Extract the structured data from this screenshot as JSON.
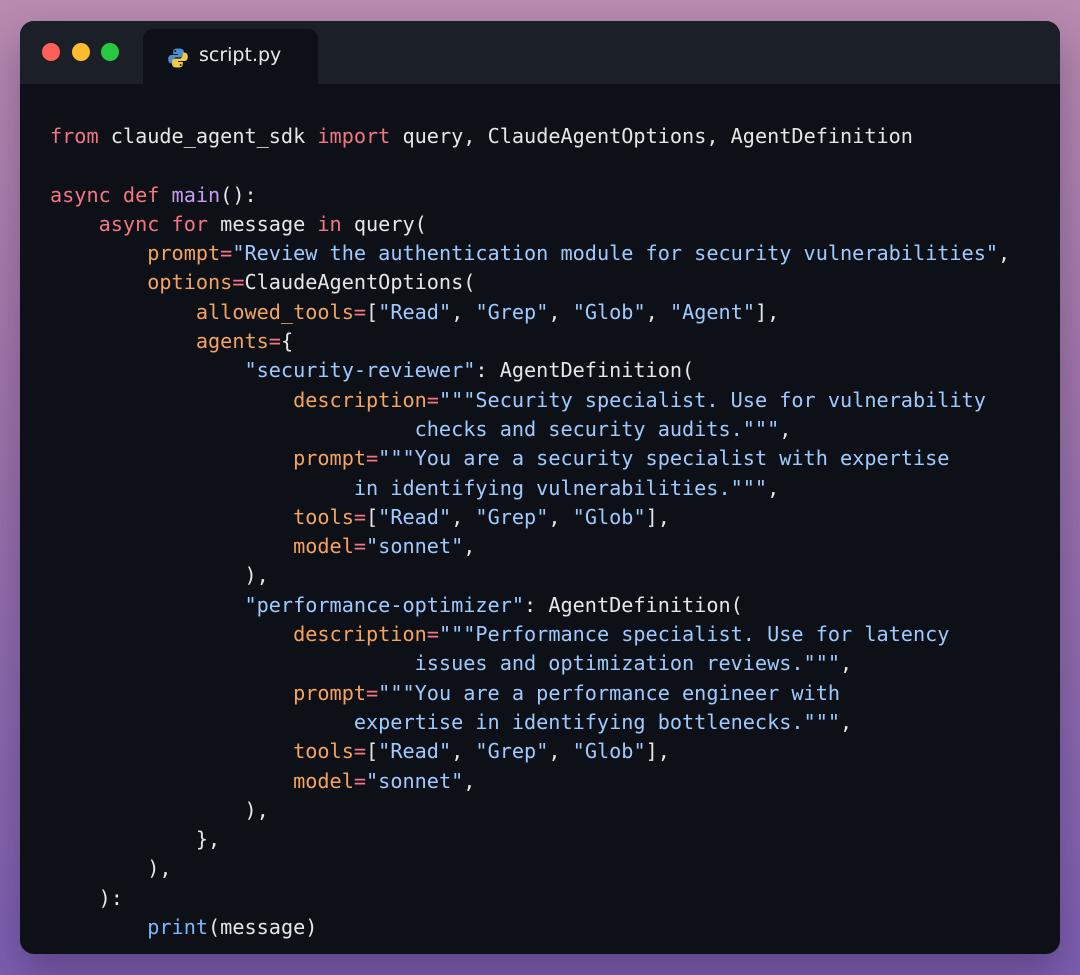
{
  "window": {
    "traffic_lights": {
      "close": "#ff5f57",
      "minimize": "#febc2e",
      "maximize": "#28c840"
    },
    "tab": {
      "label": "script.py",
      "icon": "python-icon"
    }
  },
  "theme": {
    "keyword": "#f47583",
    "function": "#c89bf0",
    "string": "#9ecbff",
    "parameter": "#f5a35e",
    "builtin": "#79b8ff",
    "plain": "#e6e6e6",
    "background": "#0d1117"
  },
  "code": {
    "lines": [
      [
        [
          "kw",
          "from"
        ],
        [
          "p",
          " claude_agent_sdk "
        ],
        [
          "kw",
          "import"
        ],
        [
          "p",
          " query, ClaudeAgentOptions, AgentDefinition"
        ]
      ],
      [],
      [
        [
          "kw",
          "async def"
        ],
        [
          "p",
          " "
        ],
        [
          "fn",
          "main"
        ],
        [
          "p",
          "():"
        ]
      ],
      [
        [
          "p",
          "    "
        ],
        [
          "kw",
          "async for"
        ],
        [
          "p",
          " message "
        ],
        [
          "kw",
          "in"
        ],
        [
          "p",
          " query("
        ]
      ],
      [
        [
          "p",
          "        "
        ],
        [
          "param",
          "prompt"
        ],
        [
          "kw",
          "="
        ],
        [
          "str",
          "\"Review the authentication module for security vulnerabilities\""
        ],
        [
          "p",
          ","
        ]
      ],
      [
        [
          "p",
          "        "
        ],
        [
          "param",
          "options"
        ],
        [
          "kw",
          "="
        ],
        [
          "p",
          "ClaudeAgentOptions("
        ]
      ],
      [
        [
          "p",
          "            "
        ],
        [
          "param",
          "allowed_tools"
        ],
        [
          "kw",
          "="
        ],
        [
          "p",
          "["
        ],
        [
          "str",
          "\"Read\""
        ],
        [
          "p",
          ", "
        ],
        [
          "str",
          "\"Grep\""
        ],
        [
          "p",
          ", "
        ],
        [
          "str",
          "\"Glob\""
        ],
        [
          "p",
          ", "
        ],
        [
          "str",
          "\"Agent\""
        ],
        [
          "p",
          "],"
        ]
      ],
      [
        [
          "p",
          "            "
        ],
        [
          "param",
          "agents"
        ],
        [
          "kw",
          "="
        ],
        [
          "p",
          "{"
        ]
      ],
      [
        [
          "p",
          "                "
        ],
        [
          "str",
          "\"security-reviewer\""
        ],
        [
          "p",
          ": AgentDefinition("
        ]
      ],
      [
        [
          "p",
          "                    "
        ],
        [
          "param",
          "description"
        ],
        [
          "kw",
          "="
        ],
        [
          "str",
          "\"\"\"Security specialist. Use for vulnerability"
        ]
      ],
      [
        [
          "str",
          "                              checks and security audits.\"\"\""
        ],
        [
          "p",
          ","
        ]
      ],
      [
        [
          "p",
          "                    "
        ],
        [
          "param",
          "prompt"
        ],
        [
          "kw",
          "="
        ],
        [
          "str",
          "\"\"\"You are a security specialist with expertise"
        ]
      ],
      [
        [
          "str",
          "                         in identifying vulnerabilities.\"\"\""
        ],
        [
          "p",
          ","
        ]
      ],
      [
        [
          "p",
          "                    "
        ],
        [
          "param",
          "tools"
        ],
        [
          "kw",
          "="
        ],
        [
          "p",
          "["
        ],
        [
          "str",
          "\"Read\""
        ],
        [
          "p",
          ", "
        ],
        [
          "str",
          "\"Grep\""
        ],
        [
          "p",
          ", "
        ],
        [
          "str",
          "\"Glob\""
        ],
        [
          "p",
          "],"
        ]
      ],
      [
        [
          "p",
          "                    "
        ],
        [
          "param",
          "model"
        ],
        [
          "kw",
          "="
        ],
        [
          "str",
          "\"sonnet\""
        ],
        [
          "p",
          ","
        ]
      ],
      [
        [
          "p",
          "                ),"
        ]
      ],
      [
        [
          "p",
          "                "
        ],
        [
          "str",
          "\"performance-optimizer\""
        ],
        [
          "p",
          ": AgentDefinition("
        ]
      ],
      [
        [
          "p",
          "                    "
        ],
        [
          "param",
          "description"
        ],
        [
          "kw",
          "="
        ],
        [
          "str",
          "\"\"\"Performance specialist. Use for latency"
        ]
      ],
      [
        [
          "str",
          "                              issues and optimization reviews.\"\"\""
        ],
        [
          "p",
          ","
        ]
      ],
      [
        [
          "p",
          "                    "
        ],
        [
          "param",
          "prompt"
        ],
        [
          "kw",
          "="
        ],
        [
          "str",
          "\"\"\"You are a performance engineer with"
        ]
      ],
      [
        [
          "str",
          "                         expertise in identifying bottlenecks.\"\"\""
        ],
        [
          "p",
          ","
        ]
      ],
      [
        [
          "p",
          "                    "
        ],
        [
          "param",
          "tools"
        ],
        [
          "kw",
          "="
        ],
        [
          "p",
          "["
        ],
        [
          "str",
          "\"Read\""
        ],
        [
          "p",
          ", "
        ],
        [
          "str",
          "\"Grep\""
        ],
        [
          "p",
          ", "
        ],
        [
          "str",
          "\"Glob\""
        ],
        [
          "p",
          "],"
        ]
      ],
      [
        [
          "p",
          "                    "
        ],
        [
          "param",
          "model"
        ],
        [
          "kw",
          "="
        ],
        [
          "str",
          "\"sonnet\""
        ],
        [
          "p",
          ","
        ]
      ],
      [
        [
          "p",
          "                ),"
        ]
      ],
      [
        [
          "p",
          "            },"
        ]
      ],
      [
        [
          "p",
          "        ),"
        ]
      ],
      [
        [
          "p",
          "    ):"
        ]
      ],
      [
        [
          "p",
          "        "
        ],
        [
          "bi",
          "print"
        ],
        [
          "p",
          "(message)"
        ]
      ]
    ]
  }
}
